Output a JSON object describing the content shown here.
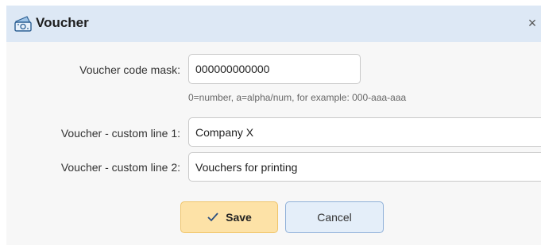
{
  "dialog": {
    "title": "Voucher",
    "close_symbol": "×"
  },
  "form": {
    "mask_label": "Voucher code mask:",
    "mask_value": "000000000000",
    "mask_hint": "0=number, a=alpha/num, for example: 000-aaa-aaa",
    "line1_label": "Voucher - custom line 1:",
    "line1_value": "Company X",
    "line2_label": "Voucher - custom line 2:",
    "line2_value": "Vouchers for printing"
  },
  "buttons": {
    "save_label": "Save",
    "cancel_label": "Cancel"
  },
  "icons": {
    "title_icon": "voucher-ticket-icon",
    "save_icon": "checkmark-icon",
    "close_icon": "close-icon"
  },
  "colors": {
    "titlebar": "#dde8f5",
    "save_button": "#fde2a7",
    "cancel_button": "#e4eef9"
  }
}
